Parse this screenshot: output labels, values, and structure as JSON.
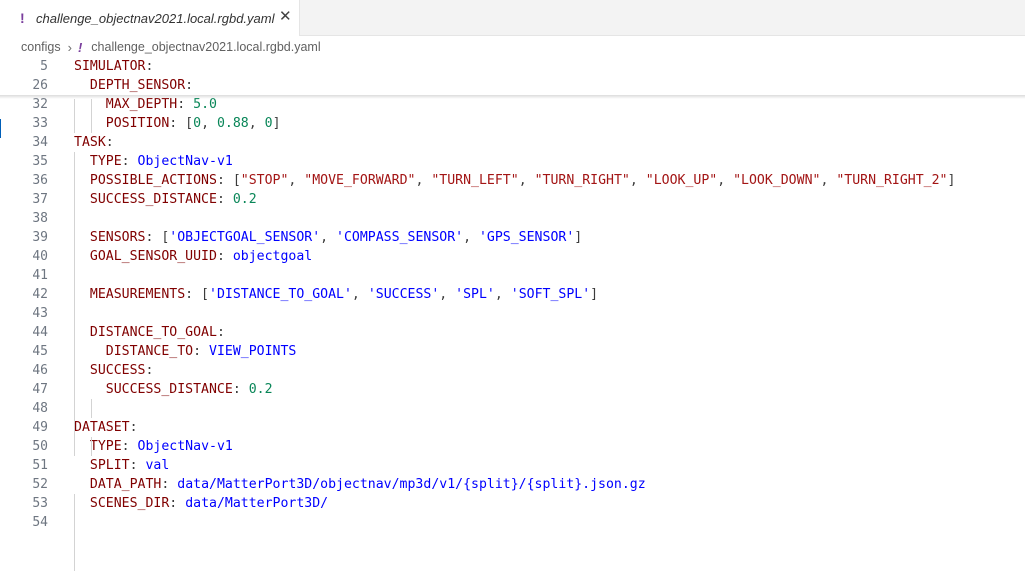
{
  "tab": {
    "icon": "yaml-exclamation-icon",
    "mark": "!",
    "title": "challenge_objectnav2021.local.rgbd.yaml",
    "close": "✕"
  },
  "breadcrumb": {
    "root": "configs",
    "separator": "›",
    "mark": "!",
    "file": "challenge_objectnav2021.local.rgbd.yaml"
  },
  "sticky_lines": [
    {
      "num": "5",
      "tokens": [
        {
          "t": "k",
          "v": "SIMULATOR"
        },
        {
          "t": "p",
          "v": ":"
        }
      ]
    },
    {
      "num": "26",
      "tokens": [
        {
          "t": "p",
          "v": "  "
        },
        {
          "t": "k",
          "v": "DEPTH_SENSOR"
        },
        {
          "t": "p",
          "v": ":"
        }
      ]
    }
  ],
  "lines": [
    {
      "num": "32",
      "tokens": [
        {
          "t": "p",
          "v": "    "
        },
        {
          "t": "k",
          "v": "MAX_DEPTH"
        },
        {
          "t": "p",
          "v": ": "
        },
        {
          "t": "n",
          "v": "5.0"
        }
      ]
    },
    {
      "num": "33",
      "tokens": [
        {
          "t": "p",
          "v": "    "
        },
        {
          "t": "k",
          "v": "POSITION"
        },
        {
          "t": "p",
          "v": ": ["
        },
        {
          "t": "n",
          "v": "0"
        },
        {
          "t": "p",
          "v": ", "
        },
        {
          "t": "n",
          "v": "0.88"
        },
        {
          "t": "p",
          "v": ", "
        },
        {
          "t": "n",
          "v": "0"
        },
        {
          "t": "p",
          "v": "]"
        }
      ]
    },
    {
      "num": "34",
      "tokens": [
        {
          "t": "k",
          "v": "TASK"
        },
        {
          "t": "p",
          "v": ":"
        }
      ]
    },
    {
      "num": "35",
      "tokens": [
        {
          "t": "p",
          "v": "  "
        },
        {
          "t": "k",
          "v": "TYPE"
        },
        {
          "t": "p",
          "v": ": "
        },
        {
          "t": "v",
          "v": "ObjectNav-v1"
        }
      ]
    },
    {
      "num": "36",
      "tokens": [
        {
          "t": "p",
          "v": "  "
        },
        {
          "t": "k",
          "v": "POSSIBLE_ACTIONS"
        },
        {
          "t": "p",
          "v": ": ["
        },
        {
          "t": "s",
          "v": "\"STOP\""
        },
        {
          "t": "p",
          "v": ", "
        },
        {
          "t": "s",
          "v": "\"MOVE_FORWARD\""
        },
        {
          "t": "p",
          "v": ", "
        },
        {
          "t": "s",
          "v": "\"TURN_LEFT\""
        },
        {
          "t": "p",
          "v": ", "
        },
        {
          "t": "s",
          "v": "\"TURN_RIGHT\""
        },
        {
          "t": "p",
          "v": ", "
        },
        {
          "t": "s",
          "v": "\"LOOK_UP\""
        },
        {
          "t": "p",
          "v": ", "
        },
        {
          "t": "s",
          "v": "\"LOOK_DOWN\""
        },
        {
          "t": "p",
          "v": ", "
        },
        {
          "t": "s",
          "v": "\"TURN_RIGHT_2\""
        },
        {
          "t": "p",
          "v": "]"
        }
      ]
    },
    {
      "num": "37",
      "tokens": [
        {
          "t": "p",
          "v": "  "
        },
        {
          "t": "k",
          "v": "SUCCESS_DISTANCE"
        },
        {
          "t": "p",
          "v": ": "
        },
        {
          "t": "n",
          "v": "0.2"
        }
      ]
    },
    {
      "num": "38",
      "tokens": []
    },
    {
      "num": "39",
      "tokens": [
        {
          "t": "p",
          "v": "  "
        },
        {
          "t": "k",
          "v": "SENSORS"
        },
        {
          "t": "p",
          "v": ": ["
        },
        {
          "t": "v",
          "v": "'OBJECTGOAL_SENSOR'"
        },
        {
          "t": "p",
          "v": ", "
        },
        {
          "t": "v",
          "v": "'COMPASS_SENSOR'"
        },
        {
          "t": "p",
          "v": ", "
        },
        {
          "t": "v",
          "v": "'GPS_SENSOR'"
        },
        {
          "t": "p",
          "v": "]"
        }
      ]
    },
    {
      "num": "40",
      "tokens": [
        {
          "t": "p",
          "v": "  "
        },
        {
          "t": "k",
          "v": "GOAL_SENSOR_UUID"
        },
        {
          "t": "p",
          "v": ": "
        },
        {
          "t": "v",
          "v": "objectgoal"
        }
      ]
    },
    {
      "num": "41",
      "tokens": []
    },
    {
      "num": "42",
      "tokens": [
        {
          "t": "p",
          "v": "  "
        },
        {
          "t": "k",
          "v": "MEASUREMENTS"
        },
        {
          "t": "p",
          "v": ": ["
        },
        {
          "t": "v",
          "v": "'DISTANCE_TO_GOAL'"
        },
        {
          "t": "p",
          "v": ", "
        },
        {
          "t": "v",
          "v": "'SUCCESS'"
        },
        {
          "t": "p",
          "v": ", "
        },
        {
          "t": "v",
          "v": "'SPL'"
        },
        {
          "t": "p",
          "v": ", "
        },
        {
          "t": "v",
          "v": "'SOFT_SPL'"
        },
        {
          "t": "p",
          "v": "]"
        }
      ]
    },
    {
      "num": "43",
      "tokens": []
    },
    {
      "num": "44",
      "tokens": [
        {
          "t": "p",
          "v": "  "
        },
        {
          "t": "k",
          "v": "DISTANCE_TO_GOAL"
        },
        {
          "t": "p",
          "v": ":"
        }
      ]
    },
    {
      "num": "45",
      "tokens": [
        {
          "t": "p",
          "v": "    "
        },
        {
          "t": "k",
          "v": "DISTANCE_TO"
        },
        {
          "t": "p",
          "v": ": "
        },
        {
          "t": "v",
          "v": "VIEW_POINTS"
        }
      ]
    },
    {
      "num": "46",
      "tokens": [
        {
          "t": "p",
          "v": "  "
        },
        {
          "t": "k",
          "v": "SUCCESS"
        },
        {
          "t": "p",
          "v": ":"
        }
      ]
    },
    {
      "num": "47",
      "tokens": [
        {
          "t": "p",
          "v": "    "
        },
        {
          "t": "k",
          "v": "SUCCESS_DISTANCE"
        },
        {
          "t": "p",
          "v": ": "
        },
        {
          "t": "n",
          "v": "0.2"
        }
      ]
    },
    {
      "num": "48",
      "tokens": []
    },
    {
      "num": "49",
      "tokens": [
        {
          "t": "k",
          "v": "DATASET"
        },
        {
          "t": "p",
          "v": ":"
        }
      ]
    },
    {
      "num": "50",
      "tokens": [
        {
          "t": "p",
          "v": "  "
        },
        {
          "t": "k",
          "v": "TYPE"
        },
        {
          "t": "p",
          "v": ": "
        },
        {
          "t": "v",
          "v": "ObjectNav-v1"
        }
      ]
    },
    {
      "num": "51",
      "tokens": [
        {
          "t": "p",
          "v": "  "
        },
        {
          "t": "k",
          "v": "SPLIT"
        },
        {
          "t": "p",
          "v": ": "
        },
        {
          "t": "v",
          "v": "val"
        }
      ]
    },
    {
      "num": "52",
      "tokens": [
        {
          "t": "p",
          "v": "  "
        },
        {
          "t": "k",
          "v": "DATA_PATH"
        },
        {
          "t": "p",
          "v": ": "
        },
        {
          "t": "v",
          "v": "data/MatterPort3D/objectnav/mp3d/v1/{split}/{split}.json.gz"
        }
      ]
    },
    {
      "num": "53",
      "tokens": [
        {
          "t": "p",
          "v": "  "
        },
        {
          "t": "k",
          "v": "SCENES_DIR"
        },
        {
          "t": "p",
          "v": ": "
        },
        {
          "t": "v",
          "v": "data/MatterPort3D/"
        }
      ]
    },
    {
      "num": "54",
      "tokens": []
    }
  ]
}
